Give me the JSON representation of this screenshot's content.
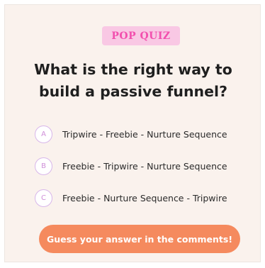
{
  "badge": {
    "label": "POP QUIZ"
  },
  "question": {
    "line1": "What is the right way to",
    "line2": "build a passive funnel?"
  },
  "options": [
    {
      "letter": "A",
      "text": "Tripwire - Freebie - Nurture Sequence"
    },
    {
      "letter": "B",
      "text": "Freebie - Tripwire - Nurture Sequence"
    },
    {
      "letter": "C",
      "text": "Freebie - Nurture Sequence - Tripwire"
    }
  ],
  "cta": {
    "label": "Guess your answer in the comments!"
  },
  "colors": {
    "background": "#faf2ed",
    "badge_bg": "#f9c8e4",
    "badge_text": "#f24fae",
    "option_circle_border": "#d8b6ea",
    "cta_bg": "#f58a5e"
  }
}
